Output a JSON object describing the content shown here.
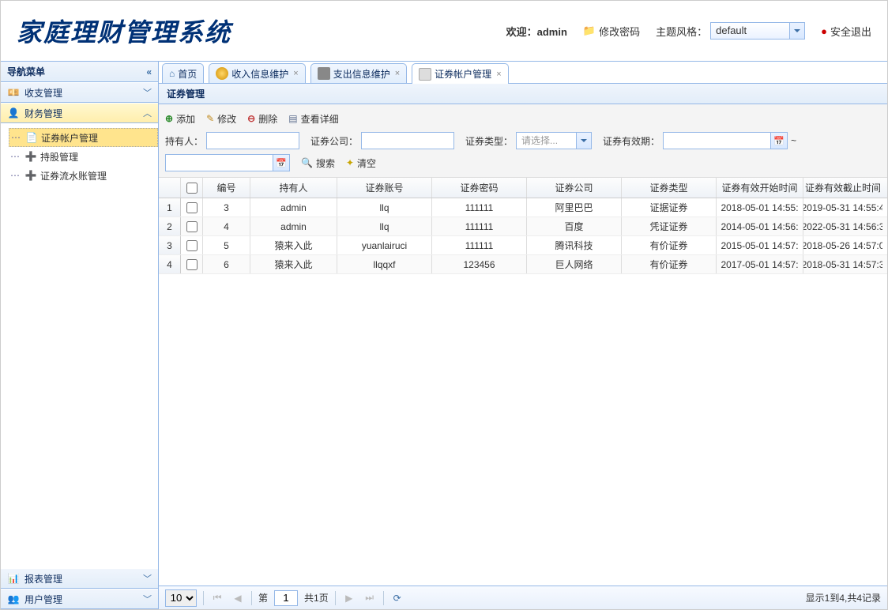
{
  "header": {
    "appTitle": "家庭理财管理系统",
    "welcomePrefix": "欢迎：",
    "username": "admin",
    "changePwd": "修改密码",
    "themeLabel": "主题风格：",
    "themeValue": "default",
    "logout": "安全退出"
  },
  "sidebar": {
    "title": "导航菜单",
    "sections": [
      {
        "label": "收支管理",
        "expanded": false
      },
      {
        "label": "财务管理",
        "expanded": true
      },
      {
        "label": "报表管理",
        "expanded": false
      },
      {
        "label": "用户管理",
        "expanded": false
      }
    ],
    "tree": [
      {
        "label": "证券帐户管理",
        "selected": true
      },
      {
        "label": "持股管理",
        "selected": false
      },
      {
        "label": "证券流水账管理",
        "selected": false
      }
    ]
  },
  "tabs": [
    {
      "label": "首页",
      "closable": false
    },
    {
      "label": "收入信息维护",
      "closable": true
    },
    {
      "label": "支出信息维护",
      "closable": true
    },
    {
      "label": "证券帐户管理",
      "closable": true,
      "active": true
    }
  ],
  "panel": {
    "title": "证券管理",
    "actions": {
      "add": "添加",
      "edit": "修改",
      "del": "删除",
      "view": "查看详细"
    },
    "filters": {
      "owner": "持有人：",
      "company": "证券公司：",
      "type": "证券类型：",
      "typePlaceholder": "请选择...",
      "expire": "证券有效期：",
      "tilde": "~",
      "search": "搜索",
      "clear": "清空"
    }
  },
  "grid": {
    "columns": [
      "编号",
      "持有人",
      "证券账号",
      "证券密码",
      "证券公司",
      "证券类型",
      "证券有效开始时间",
      "证券有效截止时间"
    ],
    "rows": [
      {
        "rn": "1",
        "id": "3",
        "owner": "admin",
        "acct": "llq",
        "pwd": "111111",
        "comp": "阿里巴巴",
        "type": "证据证券",
        "start": "2018-05-01 14:55:",
        "end": "2019-05-31 14:55:4"
      },
      {
        "rn": "2",
        "id": "4",
        "owner": "admin",
        "acct": "llq",
        "pwd": "111111",
        "comp": "百度",
        "type": "凭证证券",
        "start": "2014-05-01 14:56:",
        "end": "2022-05-31 14:56:3"
      },
      {
        "rn": "3",
        "id": "5",
        "owner": "猿来入此",
        "acct": "yuanlairuci",
        "pwd": "111111",
        "comp": "腾讯科技",
        "type": "有价证券",
        "start": "2015-05-01 14:57:",
        "end": "2018-05-26 14:57:0"
      },
      {
        "rn": "4",
        "id": "6",
        "owner": "猿来入此",
        "acct": "llqqxf",
        "pwd": "123456",
        "comp": "巨人网络",
        "type": "有价证券",
        "start": "2017-05-01 14:57:",
        "end": "2018-05-31 14:57:3"
      }
    ]
  },
  "pager": {
    "size": "10",
    "pageLabelPre": "第",
    "page": "1",
    "pageLabelPost": "共1页",
    "info": "显示1到4,共4记录"
  }
}
